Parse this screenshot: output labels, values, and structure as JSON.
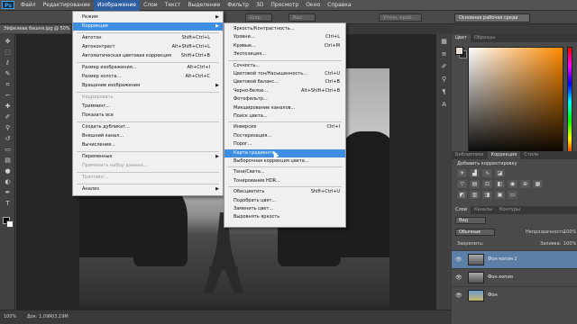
{
  "menubar": {
    "logo": "Ps",
    "items": [
      "Файл",
      "Редактирование",
      "Изображение",
      "Слои",
      "Текст",
      "Выделение",
      "Фильтр",
      "3D",
      "Просмотр",
      "Окно",
      "Справка"
    ]
  },
  "options": {
    "mode_label": "Шир:",
    "height_label": "Выс:",
    "refine_label": "Уточн. край...",
    "workspace": "Основная рабочая среда"
  },
  "tab": {
    "title": "Эйфелева башня.jpg @ 50% (Фон копия 2, RGB/8) *"
  },
  "status": {
    "zoom": "100%",
    "doc": "Док: 1,09M/3,19M"
  },
  "image_menu": {
    "items": [
      {
        "label": "Режим",
        "shortcut": "",
        "sub": true,
        "disabled": false
      },
      {
        "label": "Коррекция",
        "shortcut": "",
        "sub": true,
        "disabled": false,
        "highlight": true
      },
      {
        "label": "Автотон",
        "shortcut": "Shift+Ctrl+L",
        "sub": false,
        "disabled": false
      },
      {
        "label": "Автоконтраст",
        "shortcut": "Alt+Shift+Ctrl+L",
        "sub": false,
        "disabled": false
      },
      {
        "label": "Автоматическая цветовая коррекция",
        "shortcut": "Shift+Ctrl+B",
        "sub": false,
        "disabled": false
      },
      {
        "label": "Размер изображения...",
        "shortcut": "Alt+Ctrl+I",
        "sub": false,
        "disabled": false
      },
      {
        "label": "Размер холста...",
        "shortcut": "Alt+Ctrl+C",
        "sub": false,
        "disabled": false
      },
      {
        "label": "Вращение изображения",
        "shortcut": "",
        "sub": true,
        "disabled": false
      },
      {
        "label": "Кадрировать",
        "shortcut": "",
        "sub": false,
        "disabled": true
      },
      {
        "label": "Тримминг...",
        "shortcut": "",
        "sub": false,
        "disabled": false
      },
      {
        "label": "Показать все",
        "shortcut": "",
        "sub": false,
        "disabled": false
      },
      {
        "label": "Создать дубликат...",
        "shortcut": "",
        "sub": false,
        "disabled": false
      },
      {
        "label": "Внешний канал...",
        "shortcut": "",
        "sub": false,
        "disabled": false
      },
      {
        "label": "Вычисления...",
        "shortcut": "",
        "sub": false,
        "disabled": false
      },
      {
        "label": "Переменные",
        "shortcut": "",
        "sub": true,
        "disabled": false
      },
      {
        "label": "Применить набор данных...",
        "shortcut": "",
        "sub": false,
        "disabled": true
      },
      {
        "label": "Треппинг...",
        "shortcut": "",
        "sub": false,
        "disabled": true
      },
      {
        "label": "Анализ",
        "shortcut": "",
        "sub": true,
        "disabled": false
      }
    ]
  },
  "adjust_menu": {
    "items": [
      {
        "label": "Яркость/Контрастность...",
        "shortcut": ""
      },
      {
        "label": "Уровни...",
        "shortcut": "Ctrl+L"
      },
      {
        "label": "Кривые...",
        "shortcut": "Ctrl+M"
      },
      {
        "label": "Экспозиция...",
        "shortcut": ""
      },
      {
        "label": "Сочность...",
        "shortcut": ""
      },
      {
        "label": "Цветовой тон/Насыщенность...",
        "shortcut": "Ctrl+U"
      },
      {
        "label": "Цветовой баланс...",
        "shortcut": "Ctrl+B"
      },
      {
        "label": "Черно-белое...",
        "shortcut": "Alt+Shift+Ctrl+B"
      },
      {
        "label": "Фотофильтр...",
        "shortcut": ""
      },
      {
        "label": "Микширование каналов...",
        "shortcut": ""
      },
      {
        "label": "Поиск цвета...",
        "shortcut": ""
      },
      {
        "label": "Инверсия",
        "shortcut": "Ctrl+I"
      },
      {
        "label": "Постеризация...",
        "shortcut": ""
      },
      {
        "label": "Порог...",
        "shortcut": ""
      },
      {
        "label": "Карта градиента...",
        "shortcut": ""
      },
      {
        "label": "Выборочная коррекция цвета...",
        "shortcut": ""
      },
      {
        "label": "Тени/Света...",
        "shortcut": ""
      },
      {
        "label": "Тонирование HDR...",
        "shortcut": ""
      },
      {
        "label": "Обесцветить",
        "shortcut": "Shift+Ctrl+U"
      },
      {
        "label": "Подобрать цвет...",
        "shortcut": ""
      },
      {
        "label": "Заменить цвет...",
        "shortcut": ""
      },
      {
        "label": "Выровнять яркость",
        "shortcut": ""
      }
    ]
  },
  "color_panel": {
    "tabs": [
      "Цвет",
      "Образцы"
    ]
  },
  "adjustments_panel": {
    "tabs": [
      "Библиотеки",
      "Коррекция",
      "Стили"
    ],
    "title": "Добавить корректировку"
  },
  "layers_panel": {
    "tabs": [
      "Слои",
      "Каналы",
      "Контуры"
    ],
    "kind": "Вид",
    "blend": "Обычные",
    "opacity_label": "Непрозрачность:",
    "opacity": "100%",
    "lock_label": "Закрепить:",
    "fill_label": "Заливка:",
    "fill": "100%",
    "layers": [
      {
        "name": "Фон копия 2",
        "selected": true
      },
      {
        "name": "Фон копия",
        "selected": false
      },
      {
        "name": "Фон",
        "selected": false
      }
    ]
  },
  "colors": {
    "accent": "#3d8ee0",
    "panel": "#4a4a4a",
    "menu_bg": "#f0f0f0"
  }
}
